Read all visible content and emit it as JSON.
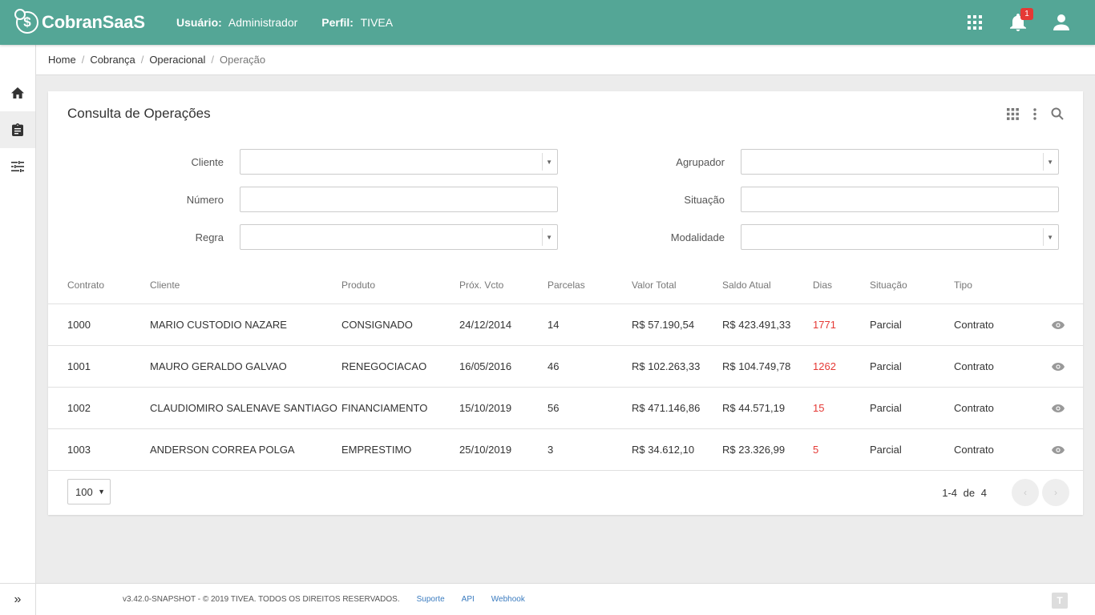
{
  "app": {
    "logo_text": "CobranSaaS",
    "logo_symbol": "$",
    "user_label": "Usuário:",
    "user_value": "Administrador",
    "profile_label": "Perfil:",
    "profile_value": "TIVEA",
    "notification_count": "1",
    "colors": {
      "topbar": "#54a696",
      "badge": "#e53935",
      "dias_red": "#e53935",
      "link": "#3a7bbf"
    }
  },
  "breadcrumb": [
    {
      "label": "Home"
    },
    {
      "label": "Cobrança"
    },
    {
      "label": "Operacional"
    },
    {
      "label": "Operação"
    }
  ],
  "card": {
    "title": "Consulta de Operações"
  },
  "filters": {
    "cliente": {
      "label": "Cliente",
      "value": ""
    },
    "numero": {
      "label": "Número",
      "value": ""
    },
    "regra": {
      "label": "Regra",
      "value": ""
    },
    "agrupador": {
      "label": "Agrupador",
      "value": ""
    },
    "situacao": {
      "label": "Situação",
      "value": ""
    },
    "modalidade": {
      "label": "Modalidade",
      "value": ""
    }
  },
  "table": {
    "headers": {
      "contrato": "Contrato",
      "cliente": "Cliente",
      "produto": "Produto",
      "vcto": "Próx. Vcto",
      "parcelas": "Parcelas",
      "valor": "Valor Total",
      "saldo": "Saldo Atual",
      "dias": "Dias",
      "situacao": "Situação",
      "tipo": "Tipo"
    },
    "rows": [
      {
        "contrato": "1000",
        "cliente": "MARIO CUSTODIO NAZARE",
        "produto": "CONSIGNADO",
        "vcto": "24/12/2014",
        "parcelas": "14",
        "valor": "R$ 57.190,54",
        "saldo": "R$ 423.491,33",
        "dias": "1771",
        "situacao": "Parcial",
        "tipo": "Contrato"
      },
      {
        "contrato": "1001",
        "cliente": "MAURO GERALDO GALVAO",
        "produto": "RENEGOCIACAO",
        "vcto": "16/05/2016",
        "parcelas": "46",
        "valor": "R$ 102.263,33",
        "saldo": "R$ 104.749,78",
        "dias": "1262",
        "situacao": "Parcial",
        "tipo": "Contrato"
      },
      {
        "contrato": "1002",
        "cliente": "CLAUDIOMIRO SALENAVE SANTIAGO",
        "produto": "FINANCIAMENTO",
        "vcto": "15/10/2019",
        "parcelas": "56",
        "valor": "R$ 471.146,86",
        "saldo": "R$ 44.571,19",
        "dias": "15",
        "situacao": "Parcial",
        "tipo": "Contrato"
      },
      {
        "contrato": "1003",
        "cliente": "ANDERSON CORREA POLGA",
        "produto": "EMPRESTIMO",
        "vcto": "25/10/2019",
        "parcelas": "3",
        "valor": "R$ 34.612,10",
        "saldo": "R$ 23.326,99",
        "dias": "5",
        "situacao": "Parcial",
        "tipo": "Contrato"
      }
    ]
  },
  "pagination": {
    "per_page": "100",
    "range": "1-4",
    "of": "de",
    "total": "4",
    "prev": "‹",
    "next": "›"
  },
  "footer": {
    "copyright": "v3.42.0-SNAPSHOT - © 2019 TIVEA. TODOS OS DIREITOS RESERVADOS.",
    "links": [
      "Suporte",
      "API",
      "Webhook"
    ]
  },
  "icons": {
    "topbar": [
      "apps-grid-icon",
      "notifications-icon",
      "account-icon"
    ],
    "sidebar": [
      "home-icon",
      "clipboard-icon",
      "tune-icon"
    ],
    "card_actions": [
      "grid-icon",
      "more-vert-icon",
      "search-icon"
    ],
    "row_action": "eye-icon",
    "sidebar_expand": "double-chevron-right-icon"
  }
}
